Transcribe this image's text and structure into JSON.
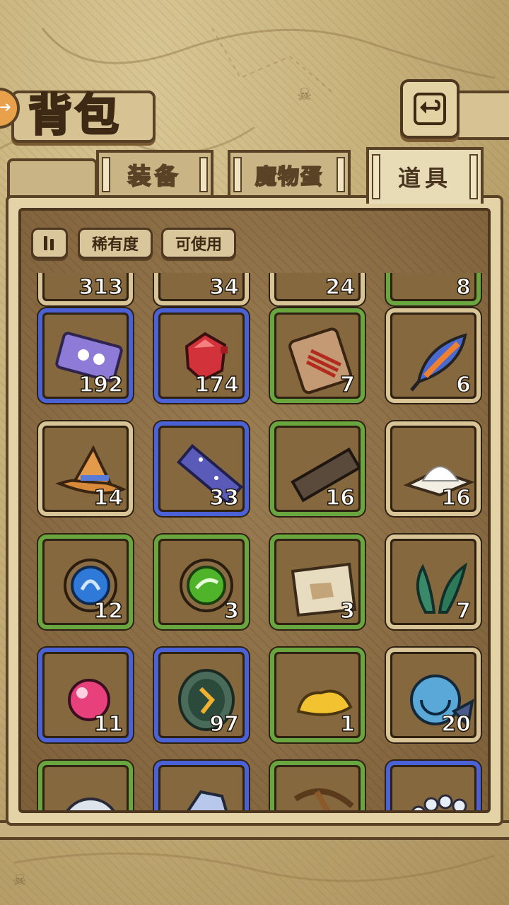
{
  "header": {
    "title": "背包"
  },
  "tabs": [
    {
      "label": "装备",
      "active": false
    },
    {
      "label": "魔物蛋",
      "active": false
    },
    {
      "label": "道具",
      "active": true
    }
  ],
  "filters": {
    "sort_icon": "pause-bars-icon",
    "rarity_label": "稀有度",
    "usable_label": "可使用"
  },
  "items": [
    {
      "count": "313",
      "border": "tan",
      "icon": "item-icon"
    },
    {
      "count": "34",
      "border": "tan",
      "icon": "item-icon"
    },
    {
      "count": "24",
      "border": "tan",
      "icon": "item-icon"
    },
    {
      "count": "8",
      "border": "green",
      "icon": "item-icon"
    },
    {
      "count": "192",
      "border": "blue",
      "icon": "ticket-icon"
    },
    {
      "count": "174",
      "border": "blue",
      "icon": "red-gem-icon"
    },
    {
      "count": "7",
      "border": "green",
      "icon": "fish-bone-plank-icon"
    },
    {
      "count": "6",
      "border": "tan",
      "icon": "feather-icon"
    },
    {
      "count": "14",
      "border": "tan",
      "icon": "witch-hat-icon"
    },
    {
      "count": "33",
      "border": "blue",
      "icon": "crystal-bar-icon"
    },
    {
      "count": "16",
      "border": "green",
      "icon": "wood-plank-icon"
    },
    {
      "count": "16",
      "border": "tan",
      "icon": "salt-pile-icon"
    },
    {
      "count": "12",
      "border": "green",
      "icon": "water-rune-icon"
    },
    {
      "count": "3",
      "border": "green",
      "icon": "wind-rune-icon"
    },
    {
      "count": "3",
      "border": "green",
      "icon": "torn-map-icon"
    },
    {
      "count": "7",
      "border": "tan",
      "icon": "seaweed-icon"
    },
    {
      "count": "11",
      "border": "blue",
      "icon": "pink-orb-icon"
    },
    {
      "count": "97",
      "border": "blue",
      "icon": "rune-coin-icon"
    },
    {
      "count": "1",
      "border": "green",
      "icon": "gold-nugget-icon"
    },
    {
      "count": "20",
      "border": "tan",
      "icon": "nautilus-shell-icon"
    },
    {
      "count": "",
      "border": "green",
      "icon": "pearl-icon"
    },
    {
      "count": "",
      "border": "blue",
      "icon": "diamond-icon"
    },
    {
      "count": "",
      "border": "green",
      "icon": "pickaxe-icon"
    },
    {
      "count": "",
      "border": "blue",
      "icon": "bead-necklace-icon"
    }
  ],
  "colors": {
    "blue": "#4b62d6",
    "green": "#6aa63f",
    "tan": "#d8c497"
  }
}
